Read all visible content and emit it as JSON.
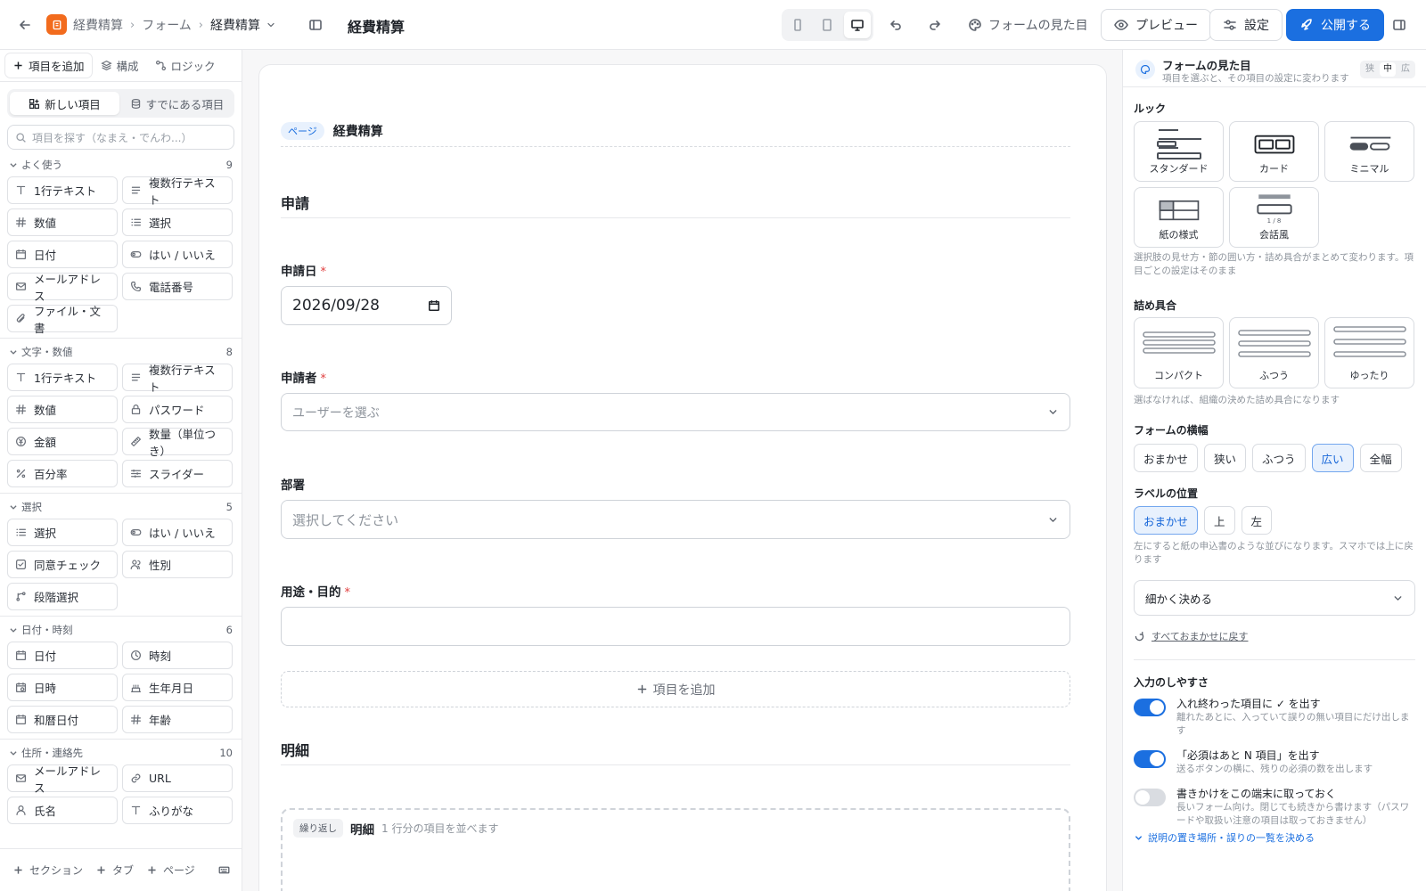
{
  "header": {
    "breadcrumbs": [
      "経費精算",
      "フォーム",
      "経費精算"
    ],
    "title": "経費精算",
    "appearance_label": "フォームの見た目",
    "preview_label": "プレビュー",
    "settings_label": "設定",
    "publish_label": "公開する",
    "accent": "#1b6fe0",
    "brand": "#f26b1d"
  },
  "left": {
    "tabs": [
      "項目を追加",
      "構成",
      "ロジック"
    ],
    "segments": [
      "新しい項目",
      "すでにある項目"
    ],
    "search_placeholder": "項目を探す（なまえ・でんわ...）",
    "groups": [
      {
        "name": "よく使う",
        "count": "9",
        "items": [
          {
            "label": "1行テキスト",
            "icon": "text-icon"
          },
          {
            "label": "複数行テキスト",
            "icon": "lines-icon"
          },
          {
            "label": "数値",
            "icon": "hash-icon"
          },
          {
            "label": "選択",
            "icon": "list-icon"
          },
          {
            "label": "日付",
            "icon": "calendar-icon"
          },
          {
            "label": "はい / いいえ",
            "icon": "toggle-icon"
          },
          {
            "label": "メールアドレス",
            "icon": "mail-icon"
          },
          {
            "label": "電話番号",
            "icon": "phone-icon"
          },
          {
            "label": "ファイル・文書",
            "icon": "paperclip-icon"
          }
        ]
      },
      {
        "name": "文字・数値",
        "count": "8",
        "items": [
          {
            "label": "1行テキスト",
            "icon": "text-icon"
          },
          {
            "label": "複数行テキスト",
            "icon": "lines-icon"
          },
          {
            "label": "数値",
            "icon": "hash-icon"
          },
          {
            "label": "パスワード",
            "icon": "lock-icon"
          },
          {
            "label": "金額",
            "icon": "coin-icon"
          },
          {
            "label": "数量（単位つき）",
            "icon": "ruler-icon"
          },
          {
            "label": "百分率",
            "icon": "percent-icon"
          },
          {
            "label": "スライダー",
            "icon": "slider-icon"
          }
        ]
      },
      {
        "name": "選択",
        "count": "5",
        "items": [
          {
            "label": "選択",
            "icon": "list-icon"
          },
          {
            "label": "はい / いいえ",
            "icon": "toggle-icon"
          },
          {
            "label": "同意チェック",
            "icon": "checkbox-icon"
          },
          {
            "label": "性別",
            "icon": "people-icon"
          },
          {
            "label": "段階選択",
            "icon": "branch-icon"
          }
        ]
      },
      {
        "name": "日付・時刻",
        "count": "6",
        "items": [
          {
            "label": "日付",
            "icon": "calendar-icon"
          },
          {
            "label": "時刻",
            "icon": "clock-icon"
          },
          {
            "label": "日時",
            "icon": "calendar-clock-icon"
          },
          {
            "label": "生年月日",
            "icon": "cake-icon"
          },
          {
            "label": "和暦日付",
            "icon": "calendar-icon"
          },
          {
            "label": "年齢",
            "icon": "hash-icon"
          }
        ]
      },
      {
        "name": "住所・連絡先",
        "count": "10",
        "items": [
          {
            "label": "メールアドレス",
            "icon": "mail-icon"
          },
          {
            "label": "URL",
            "icon": "link-icon"
          },
          {
            "label": "氏名",
            "icon": "user-icon"
          },
          {
            "label": "ふりがな",
            "icon": "text-icon"
          }
        ]
      }
    ],
    "bottom": [
      "セクション",
      "タブ",
      "ページ"
    ]
  },
  "form": {
    "page_badge": "ページ",
    "page_title": "経費精算",
    "section1": "申請",
    "fields": {
      "date_label": "申請日",
      "date_value": "2026/09/28",
      "applicant_label": "申請者",
      "applicant_placeholder": "ユーザーを選ぶ",
      "dept_label": "部署",
      "dept_placeholder": "選択してください",
      "purpose_label": "用途・目的"
    },
    "required_mark": "*",
    "add_item": "項目を追加",
    "section2": "明細",
    "repeat_badge": "繰り返し",
    "repeat_title": "明細",
    "repeat_desc": "1 行分の項目を並べます"
  },
  "right": {
    "title": "フォームの見た目",
    "subtitle": "項目を選ぶと、その項目の設定に変わります",
    "size_toggle": [
      "狭",
      "中",
      "広"
    ],
    "look_heading": "ルック",
    "looks": [
      "スタンダード",
      "カード",
      "ミニマル",
      "紙の様式",
      "会話風"
    ],
    "look_chat_counter": "1 / 8",
    "look_note": "選択肢の見せ方・節の囲い方・詰め具合がまとめて変わります。項目ごとの設定はそのまま",
    "density_heading": "詰め具合",
    "densities": [
      "コンパクト",
      "ふつう",
      "ゆったり"
    ],
    "density_note": "選ばなければ、組織の決めた詰め具合になります",
    "width_heading": "フォームの横幅",
    "widths": [
      "おまかせ",
      "狭い",
      "ふつう",
      "広い",
      "全幅"
    ],
    "width_selected": "広い",
    "labelpos_heading": "ラベルの位置",
    "labelpos": [
      "おまかせ",
      "上",
      "左"
    ],
    "labelpos_selected": "おまかせ",
    "labelpos_note": "左にすると紙の申込書のような並びになります。スマホでは上に戻ります",
    "detail_select": "細かく決める",
    "reset_link": "すべておまかせに戻す",
    "usability_heading": "入力のしやすさ",
    "toggles": [
      {
        "title": "入れ終わった項目に ✓ を出す",
        "desc": "離れたあとに、入っていて誤りの無い項目にだけ出します",
        "on": true
      },
      {
        "title": "「必須はあと N 項目」を出す",
        "desc": "送るボタンの横に、残りの必須の数を出します",
        "on": true
      },
      {
        "title": "書きかけをこの端末に取っておく",
        "desc": "長いフォーム向け。閉じても続きから書けます（パスワードや取扱い注意の項目は取っておきません）",
        "on": false
      }
    ],
    "more_link": "説明の置き場所・誤りの一覧を決める"
  }
}
